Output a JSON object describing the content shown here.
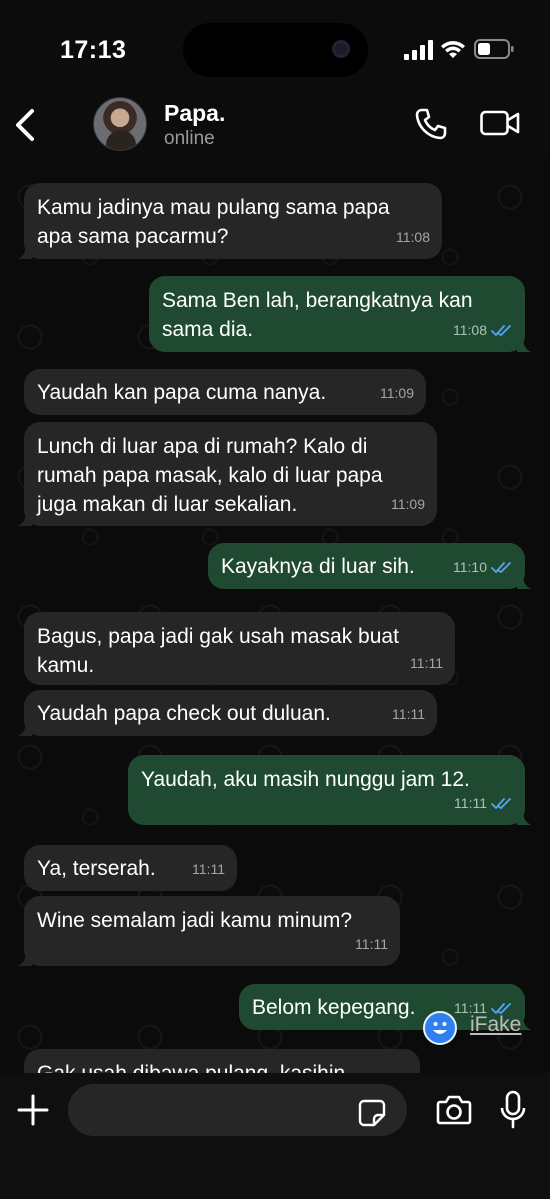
{
  "status_bar": {
    "time": "17:13"
  },
  "contact": {
    "name": "Papa.",
    "status": "online"
  },
  "messages": [
    {
      "dir": "in",
      "text": "Kamu jadinya mau pulang sama papa\napa sama pacarmu?",
      "time": "11:08"
    },
    {
      "dir": "out",
      "text": "Sama Ben lah, berangkatnya kan\nsama dia.",
      "time": "11:08"
    },
    {
      "dir": "in",
      "text": "Yaudah kan papa cuma nanya.",
      "time": "11:09"
    },
    {
      "dir": "in",
      "text": "Lunch di luar apa di rumah? Kalo di\nrumah papa masak, kalo di luar papa\njuga makan di luar sekalian.",
      "time": "11:09"
    },
    {
      "dir": "out",
      "text": "Kayaknya di luar sih.",
      "time": "11:10"
    },
    {
      "dir": "in",
      "text": "Bagus, papa jadi gak usah masak buat\nkamu.",
      "time": "11:11"
    },
    {
      "dir": "in",
      "text": "Yaudah papa check out duluan.",
      "time": "11:11"
    },
    {
      "dir": "out",
      "text": "Yaudah, aku masih nunggu jam 12.",
      "time": "11:11"
    },
    {
      "dir": "in",
      "text": "Ya, terserah.",
      "time": "11:11"
    },
    {
      "dir": "in",
      "text": "Wine semalam jadi kamu minum?",
      "time": "11:11"
    },
    {
      "dir": "out",
      "text": "Belom kepegang.",
      "time": "11:11"
    },
    {
      "dir": "in",
      "text": "Gak usah dibawa pulang, kasihin",
      "time": ""
    }
  ],
  "watermark": {
    "text": "iFake"
  },
  "composer": {
    "placeholder": ""
  },
  "colors": {
    "incoming_bubble": "#262626",
    "outgoing_bubble": "#1f4a31",
    "read_ticks": "#53a6f5"
  }
}
